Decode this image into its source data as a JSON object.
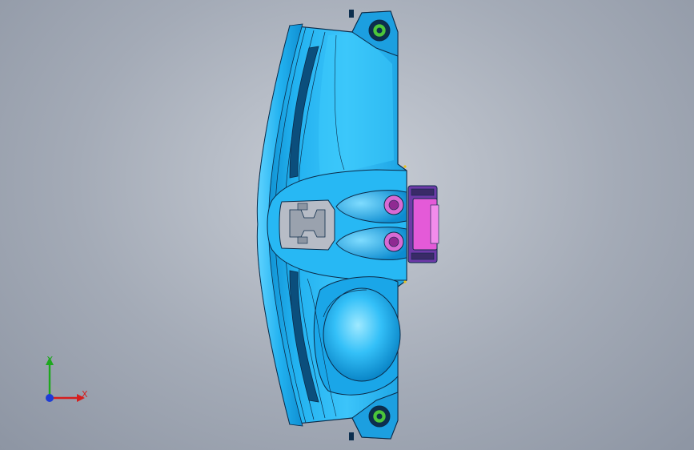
{
  "viewport": {
    "background_top": "#c9ced6",
    "background_bottom": "#8d95a3"
  },
  "model": {
    "body_color": "#22b2f0",
    "highlight_color": "#8fe4ff",
    "shadow_color": "#0a86c8",
    "edge_color": "#0b2a48",
    "connector_color": "#e45ad8",
    "accent_green": "#4cc63a"
  },
  "triad": {
    "x_label": "X",
    "y_label": "Y",
    "x_color": "#d61e1e",
    "y_color": "#1ea81e",
    "z_color": "#1e3cd6"
  }
}
